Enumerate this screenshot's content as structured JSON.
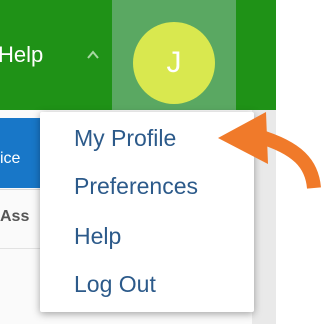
{
  "header": {
    "help_label": "Help",
    "avatar_initial": "J",
    "colors": {
      "bar": "#1f9217",
      "avatar": "#d9e84f"
    }
  },
  "background": {
    "tab_fragment": "ice",
    "column_fragment": "Ass"
  },
  "user_menu": {
    "items": [
      {
        "label": "My Profile"
      },
      {
        "label": "Preferences"
      },
      {
        "label": "Help"
      },
      {
        "label": "Log Out"
      }
    ]
  },
  "annotation": {
    "arrow_color": "#f07a2a"
  }
}
